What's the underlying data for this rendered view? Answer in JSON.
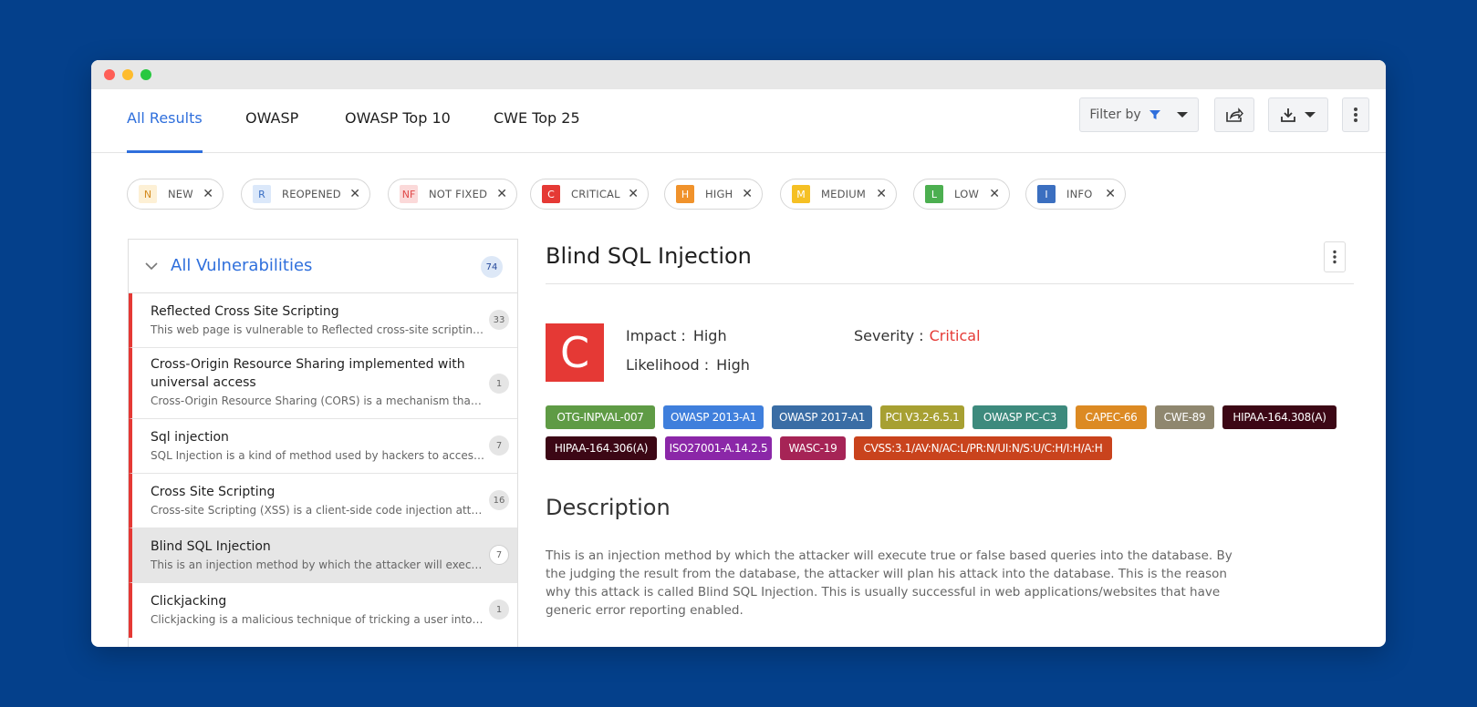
{
  "tabs": [
    {
      "label": "All Results",
      "active": true
    },
    {
      "label": "OWASP"
    },
    {
      "label": "OWASP Top 10"
    },
    {
      "label": "CWE Top 25"
    }
  ],
  "toolbar": {
    "filter_label": "Filter by",
    "icons": [
      "filter-icon",
      "caret-down-icon",
      "share-icon",
      "download-icon",
      "kebab-icon"
    ]
  },
  "filters": [
    {
      "letter": "N",
      "label": "NEW",
      "bg": "#fdf0d5",
      "fg": "#d38a1e"
    },
    {
      "letter": "R",
      "label": "REOPENED",
      "bg": "#dbe8fa",
      "fg": "#3a6fc4"
    },
    {
      "letter": "NF",
      "label": "NOT FIXED",
      "bg": "#fbd9d9",
      "fg": "#e04848"
    },
    {
      "letter": "C",
      "label": "CRITICAL",
      "bg": "#e53935",
      "fg": "#ffffff"
    },
    {
      "letter": "H",
      "label": "HIGH",
      "bg": "#f0922b",
      "fg": "#ffffff"
    },
    {
      "letter": "M",
      "label": "MEDIUM",
      "bg": "#f5c024",
      "fg": "#ffffff"
    },
    {
      "letter": "L",
      "label": "LOW",
      "bg": "#4caf50",
      "fg": "#ffffff"
    },
    {
      "letter": "I",
      "label": "INFO",
      "bg": "#3b6fc0",
      "fg": "#ffffff"
    }
  ],
  "sidebar": {
    "title": "All Vulnerabilities",
    "count": "74",
    "items": [
      {
        "title": "Reflected Cross Site Scripting",
        "desc": "This web page is vulnerable to Reflected cross-site scripting attack",
        "count": "33",
        "selected": false
      },
      {
        "title": "Cross-Origin Resource Sharing implemented with universal access",
        "desc": "Cross-Origin Resource Sharing (CORS) is a mechanism that allows resources",
        "count": "1",
        "selected": false
      },
      {
        "title": "Sql injection",
        "desc": "SQL Injection is a kind of method used by hackers to access, modify data",
        "count": "7",
        "selected": false
      },
      {
        "title": "Cross Site Scripting",
        "desc": "Cross-site Scripting (XSS) is a client-side code injection attack in which",
        "count": "16",
        "selected": false
      },
      {
        "title": "Blind SQL Injection",
        "desc": "This is an injection method by which the attacker will execute true or false",
        "count": "7",
        "selected": true
      },
      {
        "title": "Clickjacking",
        "desc": "Clickjacking is a malicious technique of tricking a user into clicking",
        "count": "1",
        "selected": false
      }
    ]
  },
  "detail": {
    "title": "Blind SQL Injection",
    "severity_letter": "C",
    "impact_label": "Impact :",
    "impact_value": "High",
    "likelihood_label": "Likelihood :",
    "likelihood_value": "High",
    "severity_label": "Severity :",
    "severity_value": "Critical",
    "tags": [
      {
        "text": "OTG-INPVAL-007",
        "color": "#5f9b45"
      },
      {
        "text": "OWASP 2013-A1",
        "color": "#3f7fdc"
      },
      {
        "text": "OWASP 2017-A1",
        "color": "#3a6da5"
      },
      {
        "text": "PCI V3.2-6.5.1",
        "color": "#a7a032"
      },
      {
        "text": "OWASP PC-C3",
        "color": "#3d8a7d"
      },
      {
        "text": "CAPEC-66",
        "color": "#dc8a23"
      },
      {
        "text": "CWE-89",
        "color": "#8f876f"
      },
      {
        "text": "HIPAA-164.308(A)",
        "color": "#3c0715"
      },
      {
        "text": "HIPAA-164.306(A)",
        "color": "#3c0715"
      },
      {
        "text": "ISO27001-A.14.2.5",
        "color": "#8b27a8"
      },
      {
        "text": "WASC-19",
        "color": "#a62456"
      },
      {
        "text": "CVSS:3.1/AV:N/AC:L/PR:N/UI:N/S:U/C:H/I:H/A:H",
        "color": "#c9431d"
      }
    ],
    "description_heading": "Description",
    "description": "This is an injection method by which the attacker will execute true or false based queries into the database. By the judging the result from the database, the attacker will plan his attack into the database. This is the reason why this attack is called Blind SQL Injection. This is usually successful in web applications/websites that have generic error reporting enabled."
  }
}
